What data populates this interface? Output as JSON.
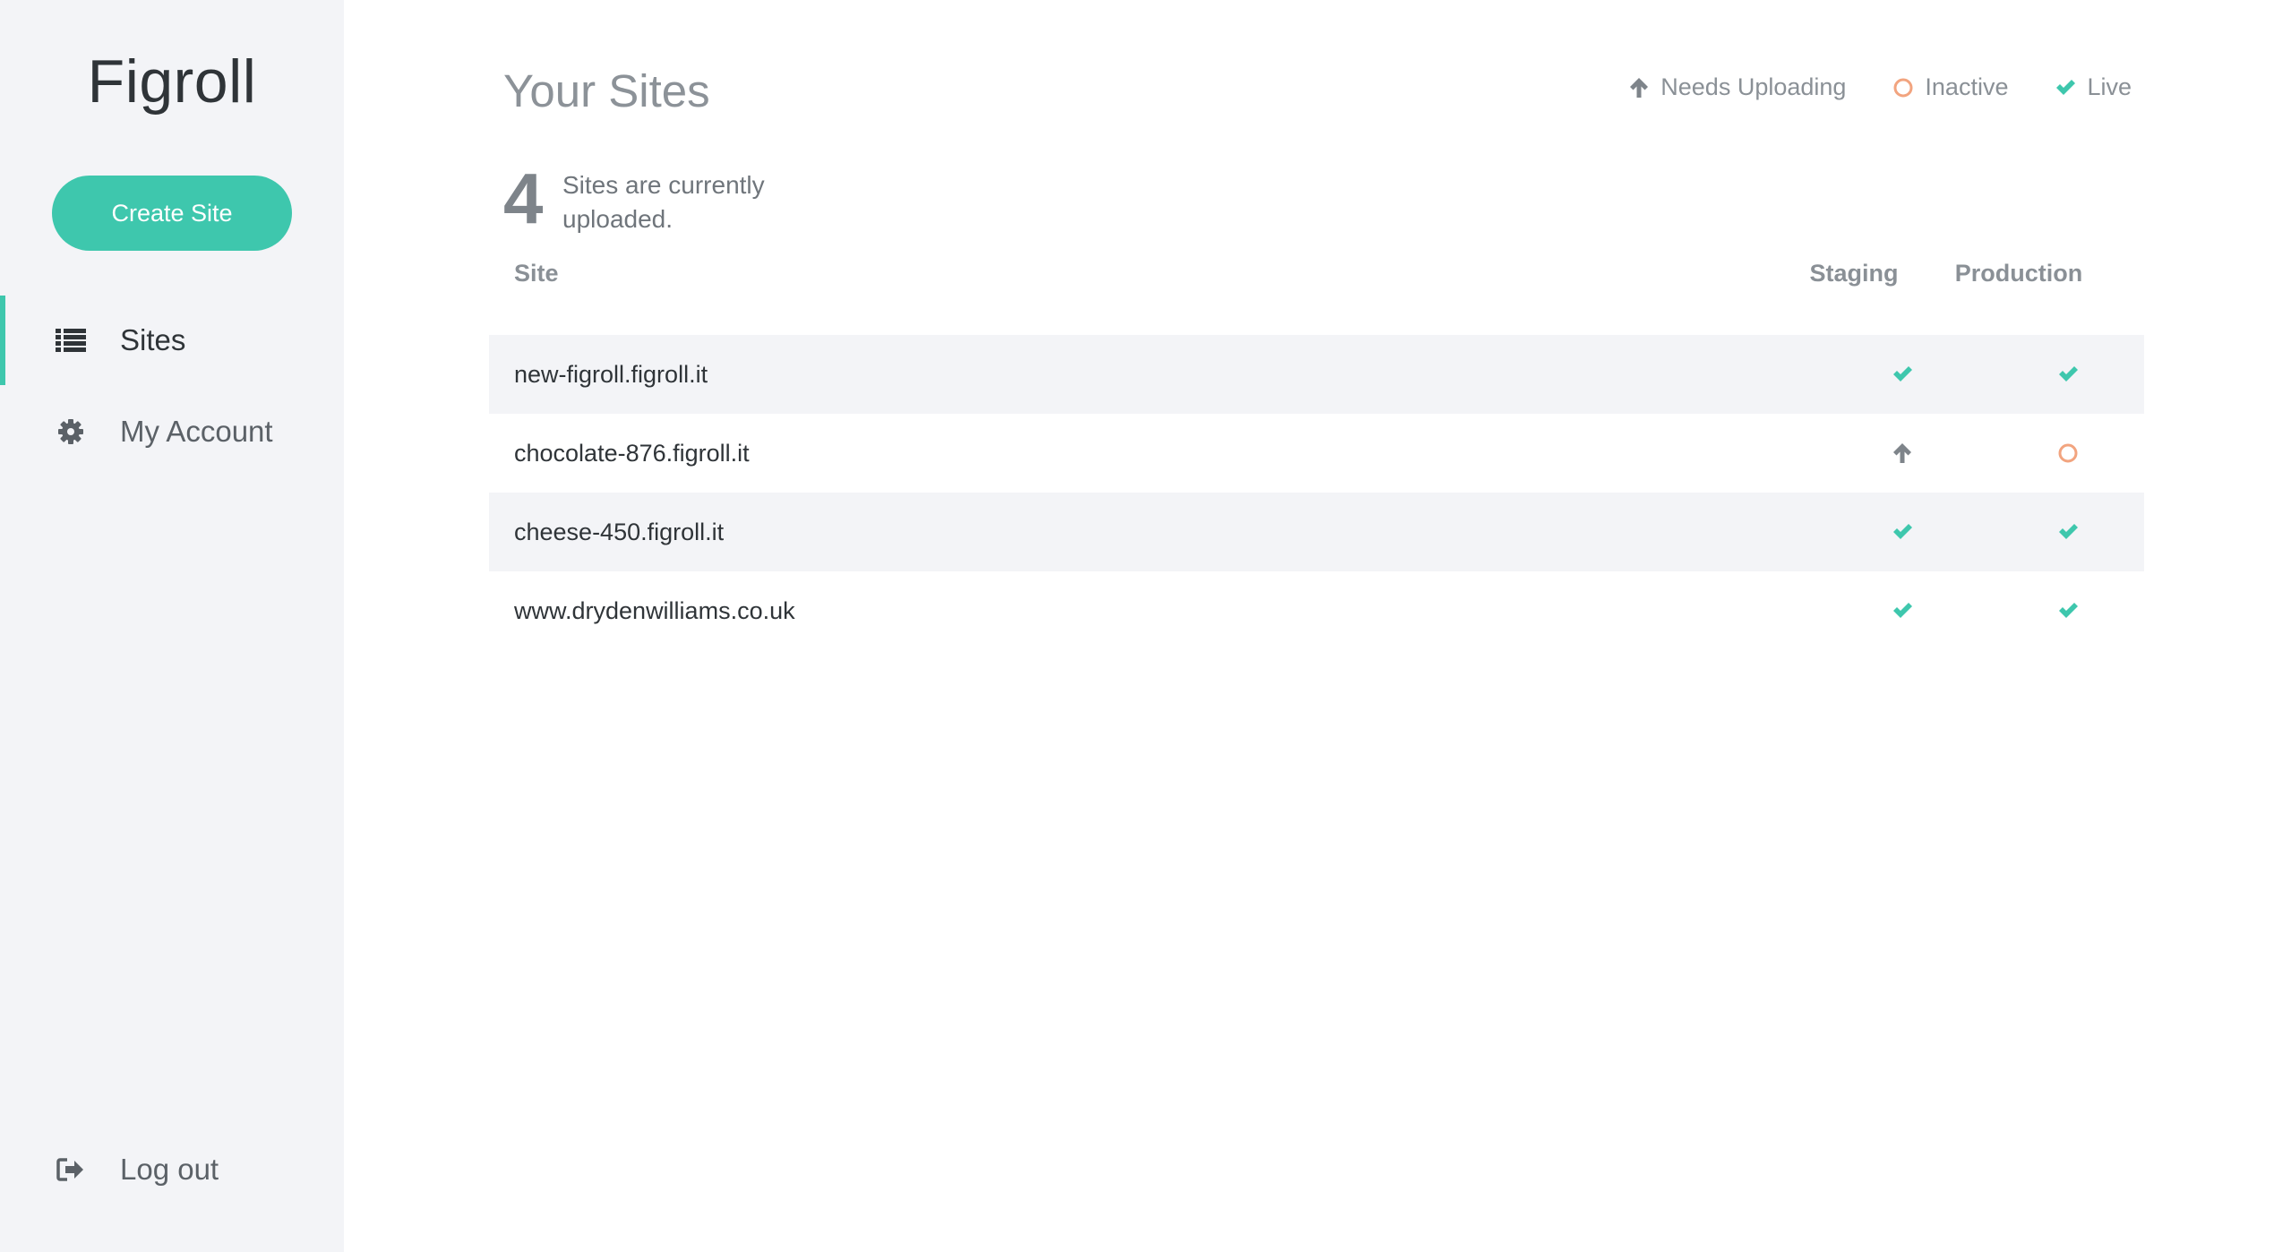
{
  "app": {
    "brand": "Figroll"
  },
  "sidebar": {
    "create_button": "Create Site",
    "items": [
      {
        "label": "Sites",
        "icon": "list-icon",
        "active": true
      },
      {
        "label": "My Account",
        "icon": "gear-icon",
        "active": false
      }
    ],
    "logout": {
      "label": "Log out",
      "icon": "sign-out-icon"
    }
  },
  "main": {
    "title": "Your Sites",
    "legend": [
      {
        "label": "Needs Uploading",
        "icon": "arrow-up-icon",
        "color": "#7e848a"
      },
      {
        "label": "Inactive",
        "icon": "circle-outline-icon",
        "color": "#f2a47f"
      },
      {
        "label": "Live",
        "icon": "check-icon",
        "color": "#3ec7ad"
      }
    ],
    "summary": {
      "count": "4",
      "text": "Sites are currently uploaded."
    },
    "table": {
      "columns": [
        "Site",
        "Staging",
        "Production"
      ],
      "rows": [
        {
          "site": "new-figroll.figroll.it",
          "staging": "live",
          "production": "live"
        },
        {
          "site": "chocolate-876.figroll.it",
          "staging": "needs-uploading",
          "production": "inactive"
        },
        {
          "site": "cheese-450.figroll.it",
          "staging": "live",
          "production": "live"
        },
        {
          "site": "www.drydenwilliams.co.uk",
          "staging": "live",
          "production": "live"
        }
      ]
    }
  },
  "colors": {
    "accent": "#3ec7ad",
    "inactive": "#f2a47f",
    "muted": "#7e848a"
  }
}
